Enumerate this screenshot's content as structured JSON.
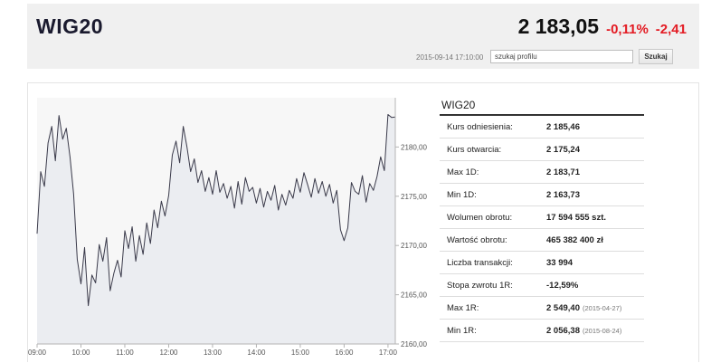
{
  "header": {
    "title": "WIG20",
    "price": "2 183,05",
    "change_pct": "-0,11%",
    "change_abs": "-2,41",
    "timestamp": "2015-09-14 17:10:00",
    "search_placeholder": "szukaj profilu",
    "search_button": "Szukaj"
  },
  "colors": {
    "negative": "#e31b23",
    "line": "#3a3a4a",
    "area": "#ebedf1"
  },
  "stats": {
    "title": "WIG20",
    "rows": [
      {
        "label": "Kurs odniesienia:",
        "value": "2 185,46",
        "date": ""
      },
      {
        "label": "Kurs otwarcia:",
        "value": "2 175,24",
        "date": ""
      },
      {
        "label": "Max 1D:",
        "value": "2 183,71",
        "date": ""
      },
      {
        "label": "Min 1D:",
        "value": "2 163,73",
        "date": ""
      },
      {
        "label": "Wolumen obrotu:",
        "value": "17 594 555 szt.",
        "date": ""
      },
      {
        "label": "Wartość obrotu:",
        "value": "465 382 400 zł",
        "date": ""
      },
      {
        "label": "Liczba transakcji:",
        "value": "33 994",
        "date": ""
      },
      {
        "label": "Stopa zwrotu 1R:",
        "value": "-12,59%",
        "date": ""
      },
      {
        "label": "Max 1R:",
        "value": "2 549,40",
        "date": "(2015-04-27)"
      },
      {
        "label": "Min 1R:",
        "value": "2 056,38",
        "date": "(2015-08-24)"
      }
    ]
  },
  "chart_data": {
    "type": "area",
    "title": "",
    "xlabel": "",
    "ylabel": "",
    "x_ticks": [
      "09:00",
      "10:00",
      "11:00",
      "12:00",
      "13:00",
      "14:00",
      "15:00",
      "16:00",
      "17:00"
    ],
    "y_ticks": [
      "2180,00",
      "2175,00",
      "2170,00",
      "2165,00",
      "2160,00"
    ],
    "ylim": [
      2160,
      2185
    ],
    "xlim": [
      "09:00",
      "17:10"
    ],
    "grid": false,
    "series": [
      {
        "x": [
          "09:00",
          "09:05",
          "09:10",
          "09:15",
          "09:20",
          "09:25",
          "09:30",
          "09:35",
          "09:40",
          "09:45",
          "09:50",
          "09:55",
          "10:00",
          "10:05",
          "10:10",
          "10:15",
          "10:20",
          "10:25",
          "10:30",
          "10:35",
          "10:40",
          "10:45",
          "10:50",
          "10:55",
          "11:00",
          "11:05",
          "11:10",
          "11:15",
          "11:20",
          "11:25",
          "11:30",
          "11:35",
          "11:40",
          "11:45",
          "11:50",
          "11:55",
          "12:00",
          "12:05",
          "12:10",
          "12:15",
          "12:20",
          "12:25",
          "12:30",
          "12:35",
          "12:40",
          "12:45",
          "12:50",
          "12:55",
          "13:00",
          "13:05",
          "13:10",
          "13:15",
          "13:20",
          "13:25",
          "13:30",
          "13:35",
          "13:40",
          "13:45",
          "13:50",
          "13:55",
          "14:00",
          "14:05",
          "14:10",
          "14:15",
          "14:20",
          "14:25",
          "14:30",
          "14:35",
          "14:40",
          "14:45",
          "14:50",
          "14:55",
          "15:00",
          "15:05",
          "15:10",
          "15:15",
          "15:20",
          "15:25",
          "15:30",
          "15:35",
          "15:40",
          "15:45",
          "15:50",
          "15:55",
          "16:00",
          "16:05",
          "16:10",
          "16:15",
          "16:20",
          "16:25",
          "16:30",
          "16:35",
          "16:40",
          "16:45",
          "16:50",
          "16:55",
          "17:00",
          "17:05",
          "17:10"
        ],
        "values": [
          2171.2,
          2177.5,
          2176.0,
          2180.4,
          2182.1,
          2178.6,
          2183.2,
          2180.8,
          2181.9,
          2179.0,
          2175.2,
          2168.6,
          2166.1,
          2169.8,
          2163.9,
          2167.0,
          2166.2,
          2170.1,
          2168.4,
          2170.8,
          2165.4,
          2167.2,
          2168.5,
          2166.8,
          2171.5,
          2169.7,
          2171.9,
          2168.4,
          2171.0,
          2169.1,
          2172.3,
          2170.2,
          2173.6,
          2171.8,
          2174.5,
          2173.0,
          2175.1,
          2179.2,
          2180.6,
          2178.4,
          2182.1,
          2180.0,
          2177.5,
          2178.8,
          2176.4,
          2177.6,
          2175.5,
          2176.9,
          2175.2,
          2177.6,
          2175.4,
          2176.3,
          2174.8,
          2176.0,
          2173.8,
          2176.5,
          2174.2,
          2176.9,
          2175.5,
          2175.9,
          2174.3,
          2175.8,
          2173.9,
          2175.5,
          2174.6,
          2176.1,
          2173.6,
          2175.2,
          2174.1,
          2175.6,
          2174.8,
          2176.8,
          2175.4,
          2177.4,
          2176.2,
          2174.9,
          2176.8,
          2175.3,
          2176.5,
          2175.0,
          2176.2,
          2174.3,
          2175.6,
          2171.6,
          2170.5,
          2171.8,
          2176.4,
          2175.5,
          2175.2,
          2177.1,
          2174.4,
          2176.3,
          2175.6,
          2177.0,
          2179.0,
          2177.6,
          2183.3,
          2183.0,
          2183.05
        ]
      }
    ]
  }
}
